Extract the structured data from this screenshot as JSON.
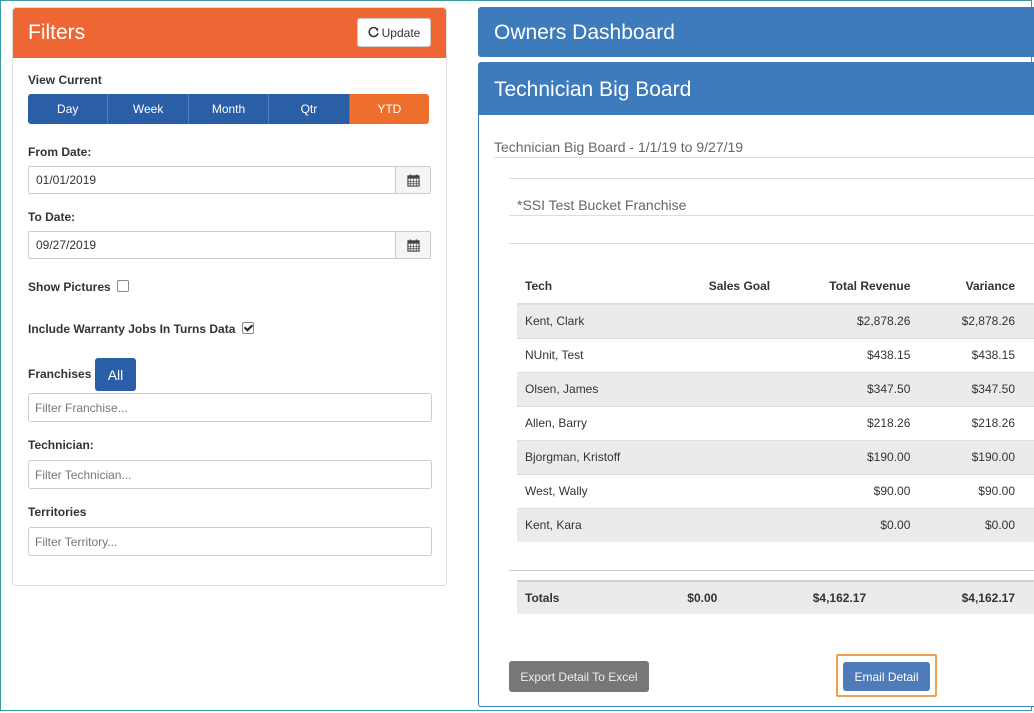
{
  "filters": {
    "title": "Filters",
    "update_label": "Update",
    "view_current_label": "View Current",
    "periods": [
      "Day",
      "Week",
      "Month",
      "Qtr",
      "YTD"
    ],
    "active_period": "YTD",
    "from_date_label": "From Date:",
    "from_date_value": "01/01/2019",
    "to_date_label": "To Date:",
    "to_date_value": "09/27/2019",
    "show_pictures_label": "Show Pictures",
    "show_pictures_checked": false,
    "include_warranty_label": "Include Warranty Jobs In Turns Data",
    "include_warranty_checked": true,
    "franchises_label": "Franchises",
    "all_label": "All",
    "franchise_placeholder": "Filter Franchise...",
    "technician_label": "Technician:",
    "technician_placeholder": "Filter Technician...",
    "territories_label": "Territories",
    "territory_placeholder": "Filter Territory..."
  },
  "owners_dashboard": {
    "title": "Owners Dashboard"
  },
  "board": {
    "title": "Technician Big Board",
    "subtitle": "Technician Big Board - 1/1/19 to 9/27/19",
    "franchise": "*SSI Test Bucket Franchise",
    "columns": [
      "Tech",
      "Sales Goal",
      "Total Revenue",
      "Variance"
    ],
    "rows": [
      [
        "Kent, Clark",
        "",
        "$2,878.26",
        "$2,878.26"
      ],
      [
        "NUnit, Test",
        "",
        "$438.15",
        "$438.15"
      ],
      [
        "Olsen, James",
        "",
        "$347.50",
        "$347.50"
      ],
      [
        "Allen, Barry",
        "",
        "$218.26",
        "$218.26"
      ],
      [
        "Bjorgman, Kristoff",
        "",
        "$190.00",
        "$190.00"
      ],
      [
        "West, Wally",
        "",
        "$90.00",
        "$90.00"
      ],
      [
        "Kent, Kara",
        "",
        "$0.00",
        "$0.00"
      ]
    ],
    "totals": [
      "Totals",
      "$0.00",
      "$4,162.17",
      "$4,162.17"
    ],
    "export_label": "Export Detail To Excel",
    "email_label": "Email Detail"
  },
  "colors": {
    "filters_header": "#ee6633",
    "primary_blue": "#3d7bbd",
    "segment_blue": "#2a5ea6",
    "active_orange": "#ee6e2c",
    "focus_ring": "#f0a050"
  }
}
